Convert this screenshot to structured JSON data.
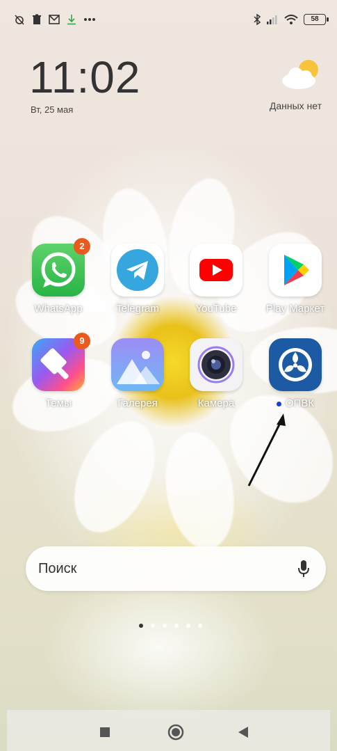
{
  "status_bar": {
    "left_icons": [
      "alarm-off-icon",
      "trash-icon",
      "mail-icon",
      "download-icon",
      "more-dots-icon"
    ],
    "right_icons": [
      "bluetooth-icon",
      "signal-icon",
      "wifi-icon"
    ],
    "battery": "58"
  },
  "clock": {
    "time": "11:02",
    "date": "Вт, 25 мая"
  },
  "weather": {
    "status": "Данных нет"
  },
  "apps": [
    {
      "label": "WhatsApp",
      "badge": "2"
    },
    {
      "label": "Telegram"
    },
    {
      "label": "YouTube"
    },
    {
      "label": "Play Маркет"
    },
    {
      "label": "Темы",
      "badge": "9"
    },
    {
      "label": "Галерея"
    },
    {
      "label": "Камера"
    },
    {
      "label": "ОПВК"
    }
  ],
  "search": {
    "placeholder": "Поиск"
  },
  "page_indicator": {
    "current": 1,
    "total": 6
  },
  "colors": {
    "badge": "#ea5a1c",
    "whatsapp": "#2fbe4a",
    "youtube": "#ff0000",
    "opvk": "#1c5aa3",
    "new_app_dot": "#1a3cd6"
  },
  "nav_bar": {
    "buttons": [
      "recents-button",
      "home-button",
      "back-button"
    ]
  }
}
